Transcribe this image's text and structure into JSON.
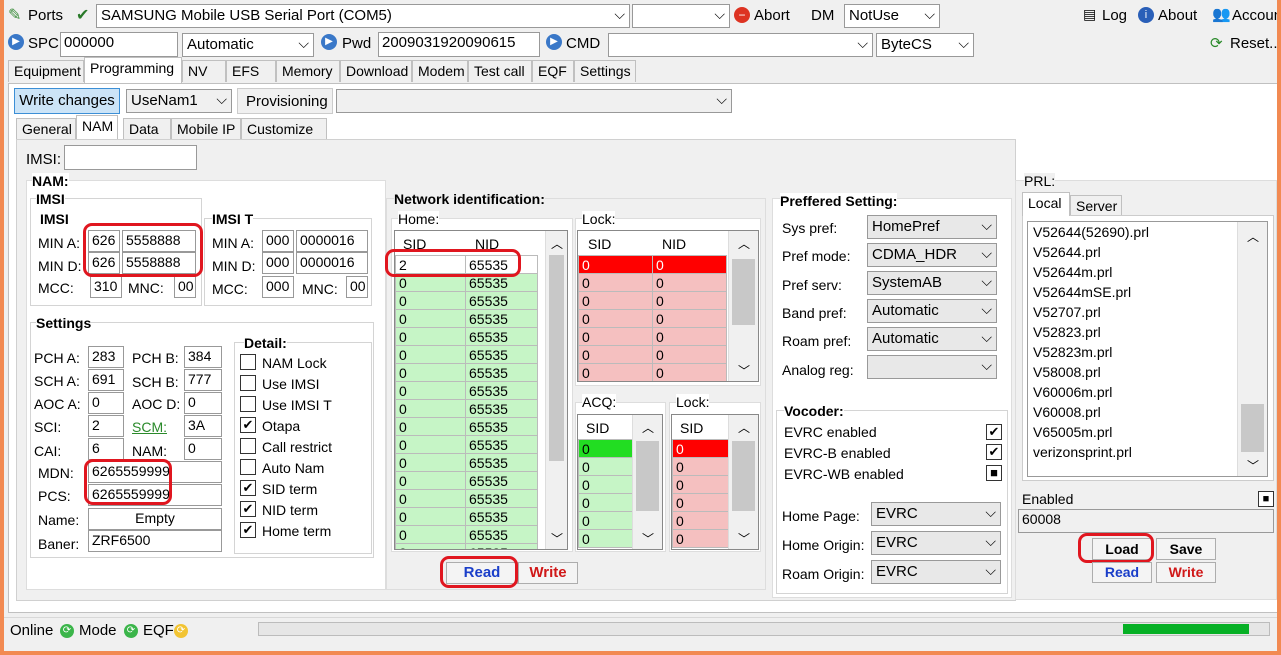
{
  "toolbar1": {
    "ports_label": "Ports",
    "port_value": "SAMSUNG Mobile USB Serial Port  (COM5)",
    "abort_label": "Abort",
    "dm_label": "DM",
    "dm_value": "NotUse",
    "log_label": "Log",
    "about_label": "About",
    "account_label": "Accoun"
  },
  "toolbar2": {
    "spc_label": "SPC",
    "spc_value": "000000",
    "mode_value": "Automatic",
    "pwd_label": "Pwd",
    "pwd_value": "2009031920090615",
    "cmd_label": "CMD",
    "bytecs_value": "ByteCS",
    "reset_label": "Reset..."
  },
  "main_tabs": [
    "Equipment",
    "Programming",
    "NV",
    "EFS",
    "Memory",
    "Download",
    "Modem",
    "Test call",
    "EQF",
    "Settings"
  ],
  "prog": {
    "write_changes": "Write changes",
    "nam_select": "UseNam1",
    "provisioning": "Provisioning"
  },
  "sub_tabs": [
    "General",
    "NAM",
    "Data",
    "Mobile IP",
    "Customize"
  ],
  "imsi_field": {
    "label": "IMSI:",
    "value": ""
  },
  "nam": {
    "title": "NAM:",
    "imsi_title": "IMSI",
    "imsi_sub": "IMSI",
    "imsi_t_title": "IMSI T",
    "min_a_label": "MIN A:",
    "min_a_1": "626",
    "min_a_2": "5558888",
    "min_d_label": "MIN D:",
    "min_d_1": "626",
    "min_d_2": "5558888",
    "mcc_label": "MCC:",
    "mcc": "310",
    "mnc_label": "MNC:",
    "mnc": "00",
    "t_min_a_1": "000",
    "t_min_a_2": "0000016",
    "t_min_d_1": "000",
    "t_min_d_2": "0000016",
    "t_mcc": "000",
    "t_mnc": "00"
  },
  "settings": {
    "title": "Settings",
    "pch_a_label": "PCH A:",
    "pch_a": "283",
    "pch_b_label": "PCH B:",
    "pch_b": "384",
    "sch_a_label": "SCH A:",
    "sch_a": "691",
    "sch_b_label": "SCH B:",
    "sch_b": "777",
    "aoc_a_label": "AOC A:",
    "aoc_a": "0",
    "aoc_d_label": "AOC D:",
    "aoc_d": "0",
    "sci_label": "SCI:",
    "sci": "2",
    "scm_label": "SCM:",
    "scm": "3A",
    "cai_label": "CAI:",
    "cai": "6",
    "nam_label": "NAM:",
    "nam": "0",
    "mdn_label": "MDN:",
    "mdn": "6265559999",
    "pcs_label": "PCS:",
    "pcs": "6265559999",
    "name_label": "Name:",
    "name": "Empty",
    "baner_label": "Baner:",
    "baner": "ZRF6500"
  },
  "detail": {
    "title": "Detail:",
    "items": [
      {
        "label": "NAM Lock",
        "checked": false
      },
      {
        "label": "Use IMSI",
        "checked": false
      },
      {
        "label": "Use IMSI T",
        "checked": false
      },
      {
        "label": "Otapa",
        "checked": true
      },
      {
        "label": "Call restrict",
        "checked": false
      },
      {
        "label": "Auto Nam",
        "checked": false
      },
      {
        "label": "SID term",
        "checked": true
      },
      {
        "label": "NID term",
        "checked": true
      },
      {
        "label": "Home term",
        "checked": true
      }
    ]
  },
  "network": {
    "title": "Network identification:",
    "home_label": "Home:",
    "lock_label": "Lock:",
    "acq_label": "ACQ:",
    "lock2_label": "Lock:",
    "sid_header": "SID",
    "nid_header": "NID",
    "home_rows": [
      [
        "2",
        "65535"
      ],
      [
        "0",
        "65535"
      ],
      [
        "0",
        "65535"
      ],
      [
        "0",
        "65535"
      ],
      [
        "0",
        "65535"
      ],
      [
        "0",
        "65535"
      ],
      [
        "0",
        "65535"
      ],
      [
        "0",
        "65535"
      ],
      [
        "0",
        "65535"
      ],
      [
        "0",
        "65535"
      ],
      [
        "0",
        "65535"
      ],
      [
        "0",
        "65535"
      ],
      [
        "0",
        "65535"
      ],
      [
        "0",
        "65535"
      ],
      [
        "0",
        "65535"
      ],
      [
        "0",
        "65535"
      ],
      [
        "0",
        "65535"
      ]
    ],
    "lock_rows": [
      [
        "0",
        "0"
      ],
      [
        "0",
        "0"
      ],
      [
        "0",
        "0"
      ],
      [
        "0",
        "0"
      ],
      [
        "0",
        "0"
      ],
      [
        "0",
        "0"
      ],
      [
        "0",
        "0"
      ]
    ],
    "acq_rows": [
      "0",
      "0",
      "0",
      "0",
      "0",
      "0"
    ],
    "lock2_rows": [
      "0",
      "0",
      "0",
      "0",
      "0",
      "0"
    ],
    "read_label": "Read",
    "write_label": "Write"
  },
  "pref": {
    "title": "Preffered Setting:",
    "sys_pref_label": "Sys pref:",
    "sys_pref": "HomePref",
    "pref_mode_label": "Pref mode:",
    "pref_mode": "CDMA_HDR",
    "pref_serv_label": "Pref serv:",
    "pref_serv": "SystemAB",
    "band_pref_label": "Band pref:",
    "band_pref": "Automatic",
    "roam_pref_label": "Roam pref:",
    "roam_pref": "Automatic",
    "analog_reg_label": "Analog reg:",
    "analog_reg": ""
  },
  "vocoder": {
    "title": "Vocoder:",
    "evrc": "EVRC enabled",
    "evrc_b": "EVRC-B enabled",
    "evrc_wb": "EVRC-WB enabled",
    "home_page_label": "Home Page:",
    "home_page": "EVRC",
    "home_origin_label": "Home Origin:",
    "home_origin": "EVRC",
    "roam_origin_label": "Roam Origin:",
    "roam_origin": "EVRC"
  },
  "prl": {
    "title": "PRL:",
    "tab_local": "Local",
    "tab_server": "Server",
    "files": [
      "V52644(52690).prl",
      "V52644.prl",
      "V52644m.prl",
      "V52644mSE.prl",
      "V52707.prl",
      "V52823.prl",
      "V52823m.prl",
      "V58008.prl",
      "V60006m.prl",
      "V60008.prl",
      "V65005m.prl",
      "verizonsprint.prl"
    ],
    "enabled_label": "Enabled",
    "value": "60008",
    "load_label": "Load",
    "save_label": "Save",
    "read_label": "Read",
    "write_label": "Write"
  },
  "status": {
    "online": "Online",
    "mode": "Mode",
    "eqf": "EQF",
    "progress": 0.95
  },
  "colors": {
    "accent_red": "#e0161f",
    "green_cell": "#c6f5c6",
    "red_cell": "#f5c0c0",
    "progress": "#06b025",
    "orange_border": "#f28a52"
  }
}
